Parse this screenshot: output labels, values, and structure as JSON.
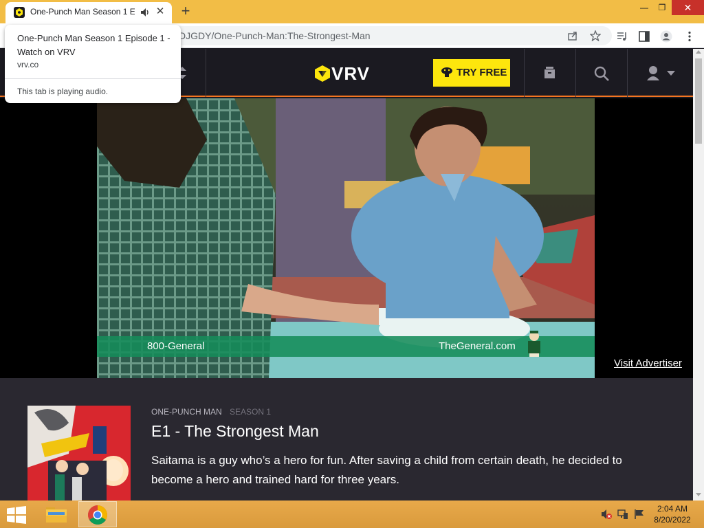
{
  "browser": {
    "tab": {
      "title": "One-Punch Man Season 1 Episode 1 - Watch on VRV",
      "close_glyph": "✕"
    },
    "new_tab_glyph": "+",
    "window_controls": {
      "minimize": "—",
      "maximize": "❐",
      "close": "✕"
    },
    "address_bar": {
      "url": "DJGDY/One-Punch-Man:The-Strongest-Man"
    },
    "hover_card": {
      "title": "One-Punch Man Season 1 Episode 1 - Watch on VRV",
      "domain": "vrv.co",
      "audio_note": "This tab is playing audio."
    },
    "icons": [
      "vrv-favicon",
      "audio-icon",
      "share-icon",
      "bookmark-star-icon",
      "media-control-icon",
      "side-panel-icon",
      "profile-icon",
      "menu-dots-icon"
    ]
  },
  "vrv": {
    "logo_text": "VRV",
    "try_free_label": "TRY FREE",
    "colors": {
      "header_bg": "#1b1a21",
      "accent": "#f47521",
      "try_free_bg": "#fde60d",
      "info_bg": "#2a2830"
    },
    "icons": [
      "menu-icon",
      "watchlist-icon",
      "search-icon",
      "account-icon"
    ]
  },
  "ad": {
    "phone": "800-General",
    "site": "TheGeneral.com",
    "visit_label": "Visit Advertiser"
  },
  "episode": {
    "series": "ONE-PUNCH MAN",
    "season": "SEASON 1",
    "title": "E1 - The Strongest Man",
    "description": "Saitama is a guy who’s a hero for fun. After saving a child from certain death, he decided to become a hero and trained hard for three years."
  },
  "taskbar": {
    "apps": [
      "file-explorer",
      "google-chrome"
    ],
    "tray_icons": [
      "volume-muted-icon",
      "network-icon",
      "flag-icon"
    ],
    "time": "2:04 AM",
    "date": "8/20/2022"
  }
}
